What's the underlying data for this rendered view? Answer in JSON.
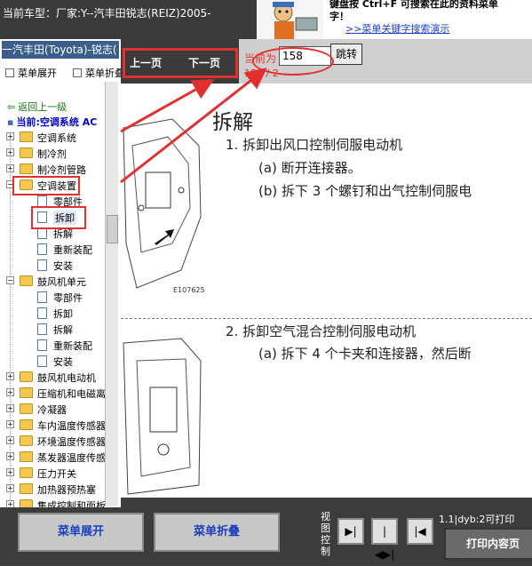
{
  "top": {
    "car_model_text": "当前车型：厂家:Y--汽丰田锐志(REIZ)2005-",
    "promo_line1": "键盘按  Ctrl+F  可搜索在此的资料菜单",
    "promo_line2": "字！",
    "promo_link": ">>菜单关键字搜索演示"
  },
  "tree": {
    "header": "一汽丰田(Toyota)-锐志(",
    "expand_label": "菜单展开",
    "collapse_label": "菜单折叠",
    "back_label": "返回上一级",
    "current_label": "当前:空调系统 AC",
    "items": [
      {
        "label": "空调系统",
        "type": "folder"
      },
      {
        "label": "制冷剂",
        "type": "folder"
      },
      {
        "label": "制冷剂管路",
        "type": "folder"
      },
      {
        "label": "空调装置",
        "type": "folder",
        "expanded": true
      },
      {
        "label": "零部件",
        "type": "doc"
      },
      {
        "label": "拆卸",
        "type": "doc",
        "selected": true
      },
      {
        "label": "拆解",
        "type": "doc"
      },
      {
        "label": "重新装配",
        "type": "doc"
      },
      {
        "label": "安装",
        "type": "doc"
      },
      {
        "label": "鼓风机单元",
        "type": "folder",
        "expanded": true
      },
      {
        "label": "零部件",
        "type": "doc"
      },
      {
        "label": "拆卸",
        "type": "doc"
      },
      {
        "label": "拆解",
        "type": "doc"
      },
      {
        "label": "重新装配",
        "type": "doc"
      },
      {
        "label": "安装",
        "type": "doc"
      },
      {
        "label": "鼓风机电动机",
        "type": "folder"
      },
      {
        "label": "压缩机和电磁离",
        "type": "folder"
      },
      {
        "label": "冷凝器",
        "type": "folder"
      },
      {
        "label": "车内温度传感器",
        "type": "folder"
      },
      {
        "label": "环境温度传感器",
        "type": "folder"
      },
      {
        "label": "蒸发器温度传感",
        "type": "folder"
      },
      {
        "label": "压力开关",
        "type": "folder"
      },
      {
        "label": "加热器预热塞",
        "type": "folder"
      },
      {
        "label": "集成控制和面板",
        "type": "folder"
      }
    ]
  },
  "nav": {
    "prev_label": "上一页",
    "next_label": "下一页",
    "current_prefix": "当前为",
    "page_value": "158",
    "jump_label": "跳转",
    "page_count": "158 / 2"
  },
  "document": {
    "title": "拆解",
    "line1": "1.   拆卸出风口控制伺服电动机",
    "line1a": "(a)  断开连接器。",
    "line1b": "(b)  拆下 3 个螺钉和出气控制伺服电",
    "figure_code": "E107625",
    "line2": "2.   拆卸空气混合控制伺服电动机",
    "line2a": "(a)  拆下 4 个卡夹和连接器，然后断"
  },
  "bottom": {
    "expand_button": "菜单展开",
    "collapse_button": "菜单折叠",
    "view_label": "视图控制",
    "view_buttons": [
      "▶|",
      "|◀▶|",
      "|◀"
    ],
    "print_info": "1.1|dyb:2可打印",
    "print_button": "打印内容页"
  },
  "colors": {
    "highlight": "#e23030",
    "link": "#1a3fbf"
  }
}
